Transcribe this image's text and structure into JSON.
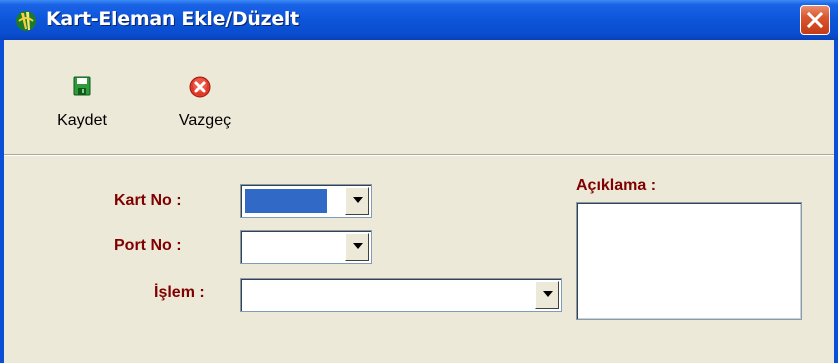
{
  "window": {
    "title": "Kart-Eleman Ekle/Düzelt"
  },
  "toolbar": {
    "save_label": "Kaydet",
    "cancel_label": "Vazgeç"
  },
  "form": {
    "kart_no_label": "Kart No :",
    "kart_no_value": "",
    "port_no_label": "Port No :",
    "port_no_value": "",
    "islem_label": "İşlem :",
    "islem_value": "",
    "aciklama_label": "Açıklama :",
    "aciklama_value": ""
  },
  "icons": {
    "app": "app-logo-icon",
    "close": "close-icon",
    "save": "floppy-disk-icon",
    "cancel": "cancel-x-icon",
    "dropdown": "chevron-down-icon"
  },
  "colors": {
    "titlebar": "#0a4fd6",
    "label_text": "#800000",
    "window_bg": "#ece9d8",
    "selection": "#3169c6",
    "close_button": "#d9572f"
  }
}
